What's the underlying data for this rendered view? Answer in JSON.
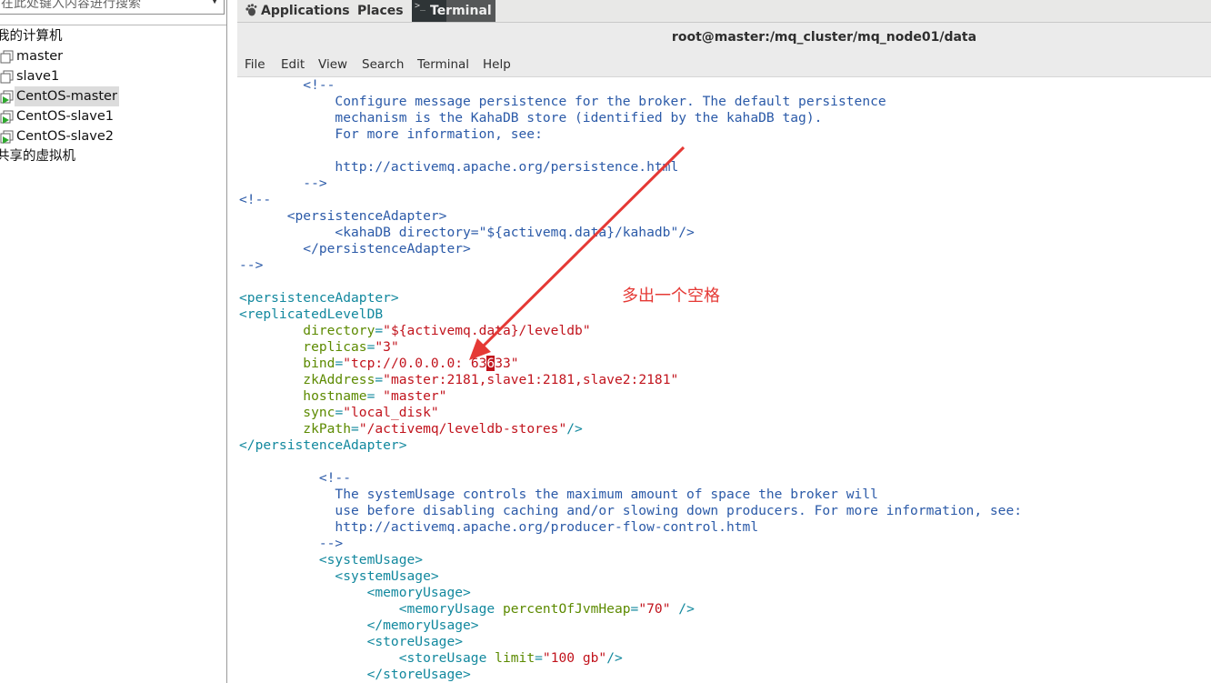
{
  "vm_library": {
    "search_placeholder": "在此处键入内容进行搜索",
    "items": [
      {
        "label": "我的计算机"
      },
      {
        "label": "master"
      },
      {
        "label": "slave1"
      },
      {
        "label": "CentOS-master"
      },
      {
        "label": "CentOS-slave1"
      },
      {
        "label": "CentOS-slave2"
      },
      {
        "label": "共享的虚拟机"
      }
    ]
  },
  "top_bar": {
    "applications": "Applications",
    "places": "Places",
    "task_terminal": "Terminal"
  },
  "window": {
    "title": "root@master:/mq_cluster/mq_node01/data",
    "menu": [
      "File",
      "Edit",
      "View",
      "Search",
      "Terminal",
      "Help"
    ]
  },
  "terminal_lines": [
    {
      "segs": [
        {
          "t": "        <!--",
          "c": "comment"
        }
      ]
    },
    {
      "segs": [
        {
          "t": "            Configure message persistence for the broker. The default persistence",
          "c": "comment"
        }
      ]
    },
    {
      "segs": [
        {
          "t": "            mechanism is the KahaDB store (identified by the kahaDB tag).",
          "c": "comment"
        }
      ]
    },
    {
      "segs": [
        {
          "t": "            For more information, see:",
          "c": "comment"
        }
      ]
    },
    {
      "segs": [
        {
          "t": "",
          "c": "comment"
        }
      ]
    },
    {
      "segs": [
        {
          "t": "            http://activemq.apache.org/persistence.html",
          "c": "comment"
        }
      ]
    },
    {
      "segs": [
        {
          "t": "        -->",
          "c": "comment"
        }
      ]
    },
    {
      "segs": [
        {
          "t": "<!--",
          "c": "comment"
        }
      ]
    },
    {
      "segs": [
        {
          "t": "      <persistenceAdapter>",
          "c": "comment"
        }
      ]
    },
    {
      "segs": [
        {
          "t": "            <kahaDB directory=\"${activemq.data}/kahadb\"/>",
          "c": "comment"
        }
      ]
    },
    {
      "segs": [
        {
          "t": "        </persistenceAdapter>",
          "c": "comment"
        }
      ]
    },
    {
      "segs": [
        {
          "t": "-->",
          "c": "comment"
        }
      ]
    },
    {
      "segs": [
        {
          "t": "",
          "c": "comment"
        }
      ]
    },
    {
      "segs": [
        {
          "t": "<persistenceAdapter>",
          "c": "tag"
        }
      ]
    },
    {
      "segs": [
        {
          "t": "<replicatedLevelDB",
          "c": "tag"
        }
      ]
    },
    {
      "segs": [
        {
          "t": "        directory",
          "c": "attr"
        },
        {
          "t": "=",
          "c": "tag"
        },
        {
          "t": "\"${activemq.data}/leveldb\"",
          "c": "val"
        }
      ]
    },
    {
      "segs": [
        {
          "t": "        replicas",
          "c": "attr"
        },
        {
          "t": "=",
          "c": "tag"
        },
        {
          "t": "\"3\"",
          "c": "val"
        }
      ]
    },
    {
      "segs": [
        {
          "t": "        bind",
          "c": "attr"
        },
        {
          "t": "=",
          "c": "tag"
        },
        {
          "t": "\"tcp://0.0.0.0: 63",
          "c": "val"
        },
        {
          "t": "6",
          "c": "cursor"
        },
        {
          "t": "33\"",
          "c": "val"
        }
      ]
    },
    {
      "segs": [
        {
          "t": "        zkAddress",
          "c": "attr"
        },
        {
          "t": "=",
          "c": "tag"
        },
        {
          "t": "\"master:2181,slave1:2181,slave2:2181\"",
          "c": "val"
        }
      ]
    },
    {
      "segs": [
        {
          "t": "        hostname",
          "c": "attr"
        },
        {
          "t": "= ",
          "c": "tag"
        },
        {
          "t": "\"master\"",
          "c": "val"
        }
      ]
    },
    {
      "segs": [
        {
          "t": "        sync",
          "c": "attr"
        },
        {
          "t": "=",
          "c": "tag"
        },
        {
          "t": "\"local_disk\"",
          "c": "val"
        }
      ]
    },
    {
      "segs": [
        {
          "t": "        zkPath",
          "c": "attr"
        },
        {
          "t": "=",
          "c": "tag"
        },
        {
          "t": "\"/activemq/leveldb-stores\"",
          "c": "val"
        },
        {
          "t": "/>",
          "c": "tag"
        }
      ]
    },
    {
      "segs": [
        {
          "t": "</persistenceAdapter>",
          "c": "tag"
        }
      ]
    },
    {
      "segs": [
        {
          "t": "",
          "c": "comment"
        }
      ]
    },
    {
      "segs": [
        {
          "t": "          <!--",
          "c": "comment"
        }
      ]
    },
    {
      "segs": [
        {
          "t": "            The systemUsage controls the maximum amount of space the broker will",
          "c": "comment"
        }
      ]
    },
    {
      "segs": [
        {
          "t": "            use before disabling caching and/or slowing down producers. For more information, see:",
          "c": "comment"
        }
      ]
    },
    {
      "segs": [
        {
          "t": "            http://activemq.apache.org/producer-flow-control.html",
          "c": "comment"
        }
      ]
    },
    {
      "segs": [
        {
          "t": "          -->",
          "c": "comment"
        }
      ]
    },
    {
      "segs": [
        {
          "t": "          <systemUsage>",
          "c": "tag"
        }
      ]
    },
    {
      "segs": [
        {
          "t": "            <systemUsage>",
          "c": "tag"
        }
      ]
    },
    {
      "segs": [
        {
          "t": "                <memoryUsage>",
          "c": "tag"
        }
      ]
    },
    {
      "segs": [
        {
          "t": "                    <memoryUsage ",
          "c": "tag"
        },
        {
          "t": "percentOfJvmHeap",
          "c": "attr"
        },
        {
          "t": "=",
          "c": "tag"
        },
        {
          "t": "\"70\"",
          "c": "val"
        },
        {
          "t": " />",
          "c": "tag"
        }
      ]
    },
    {
      "segs": [
        {
          "t": "                </memoryUsage>",
          "c": "tag"
        }
      ]
    },
    {
      "segs": [
        {
          "t": "                <storeUsage>",
          "c": "tag"
        }
      ]
    },
    {
      "segs": [
        {
          "t": "                    <storeUsage ",
          "c": "tag"
        },
        {
          "t": "limit",
          "c": "attr"
        },
        {
          "t": "=",
          "c": "tag"
        },
        {
          "t": "\"100 gb\"",
          "c": "val"
        },
        {
          "t": "/>",
          "c": "tag"
        }
      ]
    },
    {
      "segs": [
        {
          "t": "                </storeUsage>",
          "c": "tag"
        }
      ]
    }
  ],
  "annotation": {
    "note": "多出一个空格",
    "color": "#e53935"
  }
}
